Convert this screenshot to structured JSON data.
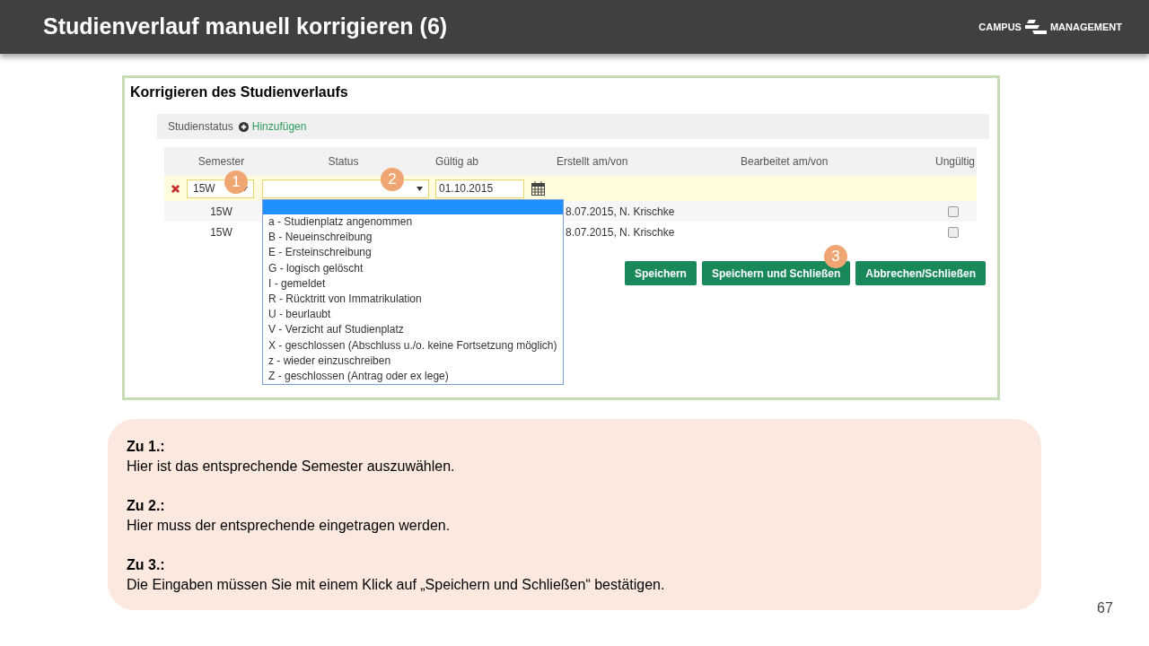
{
  "slide": {
    "title": "Studienverlauf manuell korrigieren (6)",
    "logo_left": "CAMPUS",
    "logo_right": "MANAGEMENT",
    "page_number": "67"
  },
  "panel": {
    "title": "Korrigieren des Studienverlaufs",
    "section_label": "Studienstatus",
    "add_link": "Hinzufügen",
    "columns": [
      "Semester",
      "Status",
      "Gültig ab",
      "Erstellt am/von",
      "Bearbeitet am/von",
      "Ungültig"
    ],
    "edit_row": {
      "semester": "15W",
      "valid_from": "01.10.2015"
    },
    "rows": [
      {
        "semester": "15W",
        "created": "8.07.2015, N. Krischke",
        "invalid": false
      },
      {
        "semester": "15W",
        "created": "8.07.2015, N. Krischke",
        "invalid": false
      }
    ],
    "dropdown": {
      "options": [
        "a - Studienplatz angenommen",
        "B - Neueinschreibung",
        "E - Ersteinschreibung",
        "G - logisch gelöscht",
        "I - gemeldet",
        "R - Rücktritt von Immatrikulation",
        "U - beurlaubt",
        "V - Verzicht auf Studienplatz",
        "X - geschlossen (Abschluss u./o. keine Fortsetzung möglich)",
        "z - wieder einzuschreiben",
        "Z - geschlossen (Antrag oder ex lege)"
      ]
    },
    "buttons": [
      "Speichern",
      "Speichern und Schließen",
      "Abbrechen/Schließen"
    ]
  },
  "markers": [
    "1",
    "2",
    "3"
  ],
  "notes": [
    {
      "heading": "Zu 1.:",
      "text": "Hier ist das entsprechende Semester auszuwählen."
    },
    {
      "heading": "Zu 2.:",
      "text": "Hier muss der entsprechende eingetragen werden."
    },
    {
      "heading": "Zu 3.:",
      "text": "Die Eingaben müssen Sie mit einem Klick auf „Speichern und Schließen“ bestätigen."
    }
  ]
}
